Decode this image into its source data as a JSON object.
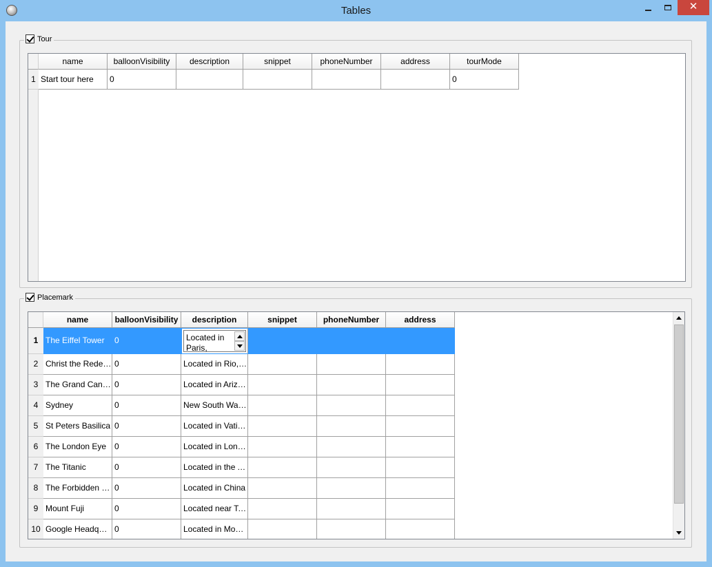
{
  "window": {
    "title": "Tables",
    "minimize_icon": "minimize-icon",
    "maximize_icon": "maximize-icon",
    "close_label": "✕"
  },
  "tour": {
    "legend": "Tour",
    "checked": true,
    "columns": [
      "name",
      "balloonVisibility",
      "description",
      "snippet",
      "phoneNumber",
      "address",
      "tourMode"
    ],
    "rows": [
      {
        "num": "1",
        "cells": [
          "Start tour here",
          "0",
          "",
          "",
          "",
          "",
          "0"
        ]
      }
    ]
  },
  "placemark": {
    "legend": "Placemark",
    "checked": true,
    "columns": [
      "name",
      "balloonVisibility",
      "description",
      "snippet",
      "phoneNumber",
      "address"
    ],
    "editor_value": "Located in Paris, France",
    "rows": [
      {
        "num": "1",
        "cells": [
          "The Eiffel Tower",
          "0",
          "",
          "",
          "",
          ""
        ]
      },
      {
        "num": "2",
        "cells": [
          "Christ the Redeemer",
          "0",
          "Located in Rio, Brazil",
          "",
          "",
          ""
        ]
      },
      {
        "num": "3",
        "cells": [
          "The Grand Canyon",
          "0",
          "Located in Arizona",
          "",
          "",
          ""
        ]
      },
      {
        "num": "4",
        "cells": [
          "Sydney",
          "0",
          "New South Wales",
          "",
          "",
          ""
        ]
      },
      {
        "num": "5",
        "cells": [
          "St Peters Basilica",
          "0",
          "Located in Vatican City",
          "",
          "",
          ""
        ]
      },
      {
        "num": "6",
        "cells": [
          "The London Eye",
          "0",
          "Located in London",
          "",
          "",
          ""
        ]
      },
      {
        "num": "7",
        "cells": [
          "The Titanic",
          "0",
          "Located in the Atlantic",
          "",
          "",
          ""
        ]
      },
      {
        "num": "8",
        "cells": [
          "The Forbidden City",
          "0",
          "Located in China",
          "",
          "",
          ""
        ]
      },
      {
        "num": "9",
        "cells": [
          "Mount Fuji",
          "0",
          "Located near Tokyo",
          "",
          "",
          ""
        ]
      },
      {
        "num": "10",
        "cells": [
          "Google Headquarters",
          "0",
          "Located in Mountain View",
          "",
          "",
          ""
        ]
      }
    ]
  }
}
